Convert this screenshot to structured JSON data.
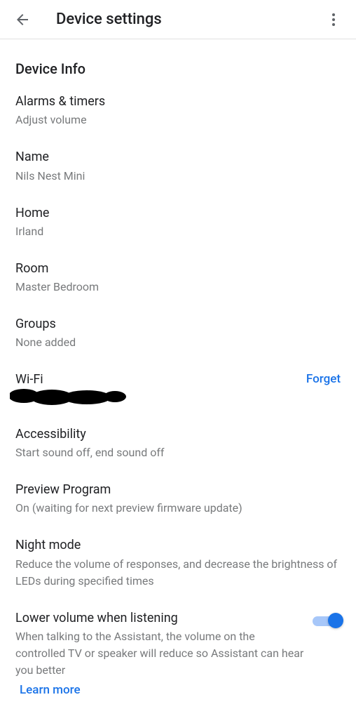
{
  "header": {
    "title": "Device settings"
  },
  "section": {
    "title": "Device Info"
  },
  "items": {
    "alarms": {
      "title": "Alarms & timers",
      "subtitle": "Adjust volume"
    },
    "name": {
      "title": "Name",
      "subtitle": "Nils Nest Mini"
    },
    "home": {
      "title": "Home",
      "subtitle": "Irland"
    },
    "room": {
      "title": "Room",
      "subtitle": "Master Bedroom"
    },
    "groups": {
      "title": "Groups",
      "subtitle": "None added"
    },
    "wifi": {
      "title": "Wi-Fi",
      "action": "Forget"
    },
    "accessibility": {
      "title": "Accessibility",
      "subtitle": "Start sound off, end sound off"
    },
    "preview": {
      "title": "Preview Program",
      "subtitle": "On (waiting for next preview firmware update)"
    },
    "night": {
      "title": "Night mode",
      "subtitle": "Reduce the volume of responses, and decrease the brightness of LEDs during specified times"
    },
    "lower_volume": {
      "title": "Lower volume when listening",
      "subtitle": "When talking to the Assistant, the volume on the controlled TV or speaker will reduce so Assistant can hear you better",
      "learn_more": "Learn more"
    }
  }
}
